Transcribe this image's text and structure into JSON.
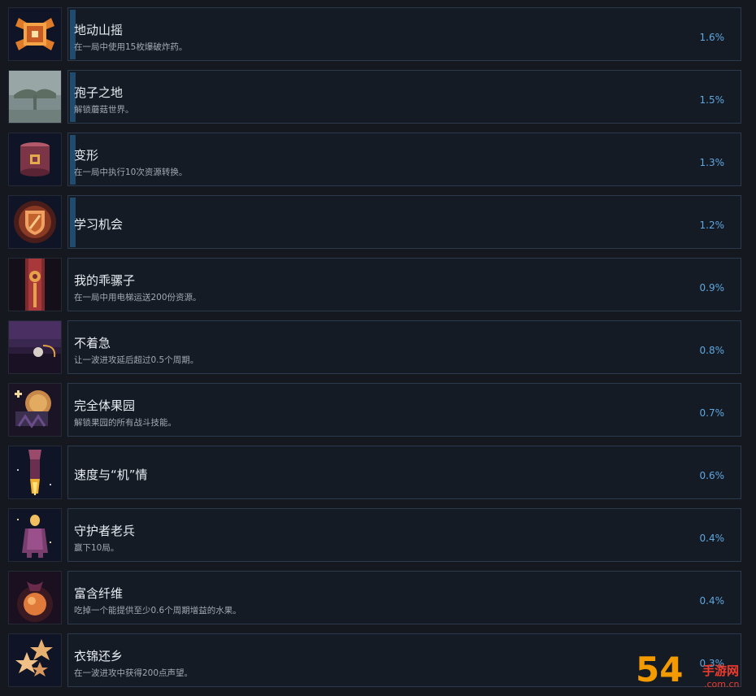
{
  "achievements": [
    {
      "name": "地动山摇",
      "desc": "在一局中使用15枚爆破炸药。",
      "pct": "1.6%",
      "bar": true,
      "icon": "explosive-chest-icon"
    },
    {
      "name": "孢子之地",
      "desc": "解锁蘑菇世界。",
      "pct": "1.5%",
      "bar": true,
      "icon": "mushroom-world-icon"
    },
    {
      "name": "变形",
      "desc": "在一局中执行10次资源转换。",
      "pct": "1.3%",
      "bar": true,
      "icon": "transform-box-icon"
    },
    {
      "name": "学习机会",
      "desc": "",
      "pct": "1.2%",
      "bar": true,
      "icon": "glowing-shield-icon"
    },
    {
      "name": "我的乖骡子",
      "desc": "在一局中用电梯运送200份资源。",
      "pct": "0.9%",
      "bar": false,
      "icon": "elevator-banner-icon"
    },
    {
      "name": "不着急",
      "desc": "让一波进攻延后超过0.5个周期。",
      "pct": "0.8%",
      "bar": false,
      "icon": "night-landscape-icon"
    },
    {
      "name": "完全体果园",
      "desc": "解锁果园的所有战斗技能。",
      "pct": "0.7%",
      "bar": false,
      "icon": "orchard-icon"
    },
    {
      "name": "速度与“机”情",
      "desc": "",
      "pct": "0.6%",
      "bar": false,
      "icon": "rocket-icon"
    },
    {
      "name": "守护者老兵",
      "desc": "赢下10局。",
      "pct": "0.4%",
      "bar": false,
      "icon": "keeper-veteran-icon"
    },
    {
      "name": "富含纤维",
      "desc": "吃掉一个能提供至少0.6个周期增益的水果。",
      "pct": "0.4%",
      "bar": false,
      "icon": "fruit-icon"
    },
    {
      "name": "衣锦还乡",
      "desc": "在一波进攻中获得200点声望。",
      "pct": "0.3%",
      "bar": false,
      "icon": "stars-icon"
    }
  ],
  "watermark": {
    "mark": "54",
    "name": "手游网",
    "url": ".com.cn"
  },
  "colors": {
    "background": "#15181f",
    "panel": "#141b25",
    "border": "#2b3a4d",
    "progress": "#214b6e",
    "percent": "#5fa7e0"
  }
}
